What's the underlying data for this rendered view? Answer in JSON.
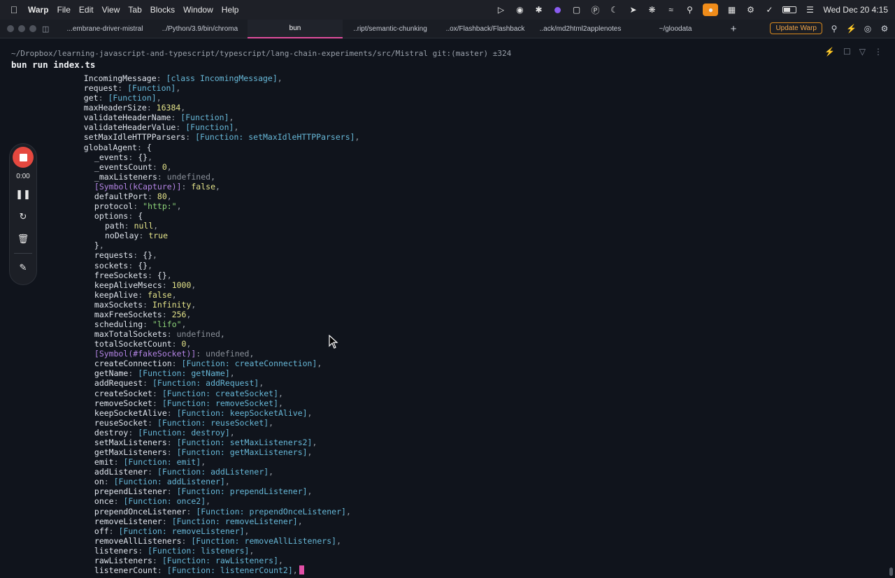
{
  "menubar": {
    "app_name": "Warp",
    "menus": [
      "File",
      "Edit",
      "View",
      "Tab",
      "Blocks",
      "Window",
      "Help"
    ],
    "clock": "Wed Dec 20  4:15"
  },
  "tabbar": {
    "tabs": [
      {
        "label": "...embrane-driver-mistral"
      },
      {
        "label": "../Python/3.9/bin/chroma"
      },
      {
        "label": "bun"
      },
      {
        "label": "..ript/semantic-chunking"
      },
      {
        "label": "..ox/Flashback/Flashback"
      },
      {
        "label": "..ack/md2html2applenotes"
      },
      {
        "label": "~/gloodata"
      }
    ],
    "new_tab_label": "+",
    "update_label": "Update Warp"
  },
  "block": {
    "path": "~/Dropbox/learning-javascript-and-typescript/typescript/lang-chain-experiments/src/Mistral git:(master) ±324",
    "command": "bun run index.ts"
  },
  "output_lines": [
    {
      "indent": 6,
      "segs": [
        [
          "k",
          "IncomingMessage"
        ],
        [
          "p",
          ": "
        ],
        [
          "fn",
          "[class IncomingMessage]"
        ],
        [
          "p",
          ","
        ]
      ]
    },
    {
      "indent": 6,
      "segs": [
        [
          "k",
          "request"
        ],
        [
          "p",
          ": "
        ],
        [
          "fn",
          "[Function]"
        ],
        [
          "p",
          ","
        ]
      ]
    },
    {
      "indent": 6,
      "segs": [
        [
          "k",
          "get"
        ],
        [
          "p",
          ": "
        ],
        [
          "fn",
          "[Function]"
        ],
        [
          "p",
          ","
        ]
      ]
    },
    {
      "indent": 6,
      "segs": [
        [
          "k",
          "maxHeaderSize"
        ],
        [
          "p",
          ": "
        ],
        [
          "num",
          "16384"
        ],
        [
          "p",
          ","
        ]
      ]
    },
    {
      "indent": 6,
      "segs": [
        [
          "k",
          "validateHeaderName"
        ],
        [
          "p",
          ": "
        ],
        [
          "fn",
          "[Function]"
        ],
        [
          "p",
          ","
        ]
      ]
    },
    {
      "indent": 6,
      "segs": [
        [
          "k",
          "validateHeaderValue"
        ],
        [
          "p",
          ": "
        ],
        [
          "fn",
          "[Function]"
        ],
        [
          "p",
          ","
        ]
      ]
    },
    {
      "indent": 6,
      "segs": [
        [
          "k",
          "setMaxIdleHTTPParsers"
        ],
        [
          "p",
          ": "
        ],
        [
          "fn",
          "[Function: setMaxIdleHTTPParsers]"
        ],
        [
          "p",
          ","
        ]
      ]
    },
    {
      "indent": 6,
      "segs": [
        [
          "k",
          "globalAgent"
        ],
        [
          "p",
          ": "
        ],
        [
          "k",
          "{"
        ]
      ]
    },
    {
      "indent": 8,
      "segs": [
        [
          "k",
          "_events"
        ],
        [
          "p",
          ": "
        ],
        [
          "k",
          "{}"
        ],
        [
          "p",
          ","
        ]
      ]
    },
    {
      "indent": 8,
      "segs": [
        [
          "k",
          "_eventsCount"
        ],
        [
          "p",
          ": "
        ],
        [
          "num",
          "0"
        ],
        [
          "p",
          ","
        ]
      ]
    },
    {
      "indent": 8,
      "segs": [
        [
          "k",
          "_maxListeners"
        ],
        [
          "p",
          ": "
        ],
        [
          "undef",
          "undefined"
        ],
        [
          "p",
          ","
        ]
      ]
    },
    {
      "indent": 8,
      "segs": [
        [
          "sym",
          "[Symbol(kCapture)]"
        ],
        [
          "p",
          ": "
        ],
        [
          "bool",
          "false"
        ],
        [
          "p",
          ","
        ]
      ]
    },
    {
      "indent": 8,
      "segs": [
        [
          "k",
          "defaultPort"
        ],
        [
          "p",
          ": "
        ],
        [
          "num",
          "80"
        ],
        [
          "p",
          ","
        ]
      ]
    },
    {
      "indent": 8,
      "segs": [
        [
          "k",
          "protocol"
        ],
        [
          "p",
          ": "
        ],
        [
          "str",
          "\"http:\""
        ],
        [
          "p",
          ","
        ]
      ]
    },
    {
      "indent": 8,
      "segs": [
        [
          "k",
          "options"
        ],
        [
          "p",
          ": "
        ],
        [
          "k",
          "{"
        ]
      ]
    },
    {
      "indent": 10,
      "segs": [
        [
          "k",
          "path"
        ],
        [
          "p",
          ": "
        ],
        [
          "bool",
          "null"
        ],
        [
          "p",
          ","
        ]
      ]
    },
    {
      "indent": 10,
      "segs": [
        [
          "k",
          "noDelay"
        ],
        [
          "p",
          ": "
        ],
        [
          "bool",
          "true"
        ]
      ]
    },
    {
      "indent": 8,
      "segs": [
        [
          "k",
          "}"
        ],
        [
          "p",
          ","
        ]
      ]
    },
    {
      "indent": 8,
      "segs": [
        [
          "k",
          "requests"
        ],
        [
          "p",
          ": "
        ],
        [
          "k",
          "{}"
        ],
        [
          "p",
          ","
        ]
      ]
    },
    {
      "indent": 8,
      "segs": [
        [
          "k",
          "sockets"
        ],
        [
          "p",
          ": "
        ],
        [
          "k",
          "{}"
        ],
        [
          "p",
          ","
        ]
      ]
    },
    {
      "indent": 8,
      "segs": [
        [
          "k",
          "freeSockets"
        ],
        [
          "p",
          ": "
        ],
        [
          "k",
          "{}"
        ],
        [
          "p",
          ","
        ]
      ]
    },
    {
      "indent": 8,
      "segs": [
        [
          "k",
          "keepAliveMsecs"
        ],
        [
          "p",
          ": "
        ],
        [
          "num",
          "1000"
        ],
        [
          "p",
          ","
        ]
      ]
    },
    {
      "indent": 8,
      "segs": [
        [
          "k",
          "keepAlive"
        ],
        [
          "p",
          ": "
        ],
        [
          "bool",
          "false"
        ],
        [
          "p",
          ","
        ]
      ]
    },
    {
      "indent": 8,
      "segs": [
        [
          "k",
          "maxSockets"
        ],
        [
          "p",
          ": "
        ],
        [
          "num",
          "Infinity"
        ],
        [
          "p",
          ","
        ]
      ]
    },
    {
      "indent": 8,
      "segs": [
        [
          "k",
          "maxFreeSockets"
        ],
        [
          "p",
          ": "
        ],
        [
          "num",
          "256"
        ],
        [
          "p",
          ","
        ]
      ]
    },
    {
      "indent": 8,
      "segs": [
        [
          "k",
          "scheduling"
        ],
        [
          "p",
          ": "
        ],
        [
          "str",
          "\"lifo\""
        ],
        [
          "p",
          ","
        ]
      ]
    },
    {
      "indent": 8,
      "segs": [
        [
          "k",
          "maxTotalSockets"
        ],
        [
          "p",
          ": "
        ],
        [
          "undef",
          "undefined"
        ],
        [
          "p",
          ","
        ]
      ]
    },
    {
      "indent": 8,
      "segs": [
        [
          "k",
          "totalSocketCount"
        ],
        [
          "p",
          ": "
        ],
        [
          "num",
          "0"
        ],
        [
          "p",
          ","
        ]
      ]
    },
    {
      "indent": 8,
      "segs": [
        [
          "sym",
          "[Symbol(#fakeSocket)]"
        ],
        [
          "p",
          ": "
        ],
        [
          "undef",
          "undefined"
        ],
        [
          "p",
          ","
        ]
      ]
    },
    {
      "indent": 8,
      "segs": [
        [
          "k",
          "createConnection"
        ],
        [
          "p",
          ": "
        ],
        [
          "fn",
          "[Function: createConnection]"
        ],
        [
          "p",
          ","
        ]
      ]
    },
    {
      "indent": 8,
      "segs": [
        [
          "k",
          "getName"
        ],
        [
          "p",
          ": "
        ],
        [
          "fn",
          "[Function: getName]"
        ],
        [
          "p",
          ","
        ]
      ]
    },
    {
      "indent": 8,
      "segs": [
        [
          "k",
          "addRequest"
        ],
        [
          "p",
          ": "
        ],
        [
          "fn",
          "[Function: addRequest]"
        ],
        [
          "p",
          ","
        ]
      ]
    },
    {
      "indent": 8,
      "segs": [
        [
          "k",
          "createSocket"
        ],
        [
          "p",
          ": "
        ],
        [
          "fn",
          "[Function: createSocket]"
        ],
        [
          "p",
          ","
        ]
      ]
    },
    {
      "indent": 8,
      "segs": [
        [
          "k",
          "removeSocket"
        ],
        [
          "p",
          ": "
        ],
        [
          "fn",
          "[Function: removeSocket]"
        ],
        [
          "p",
          ","
        ]
      ]
    },
    {
      "indent": 8,
      "segs": [
        [
          "k",
          "keepSocketAlive"
        ],
        [
          "p",
          ": "
        ],
        [
          "fn",
          "[Function: keepSocketAlive]"
        ],
        [
          "p",
          ","
        ]
      ]
    },
    {
      "indent": 8,
      "segs": [
        [
          "k",
          "reuseSocket"
        ],
        [
          "p",
          ": "
        ],
        [
          "fn",
          "[Function: reuseSocket]"
        ],
        [
          "p",
          ","
        ]
      ]
    },
    {
      "indent": 8,
      "segs": [
        [
          "k",
          "destroy"
        ],
        [
          "p",
          ": "
        ],
        [
          "fn",
          "[Function: destroy]"
        ],
        [
          "p",
          ","
        ]
      ]
    },
    {
      "indent": 8,
      "segs": [
        [
          "k",
          "setMaxListeners"
        ],
        [
          "p",
          ": "
        ],
        [
          "fn",
          "[Function: setMaxListeners2]"
        ],
        [
          "p",
          ","
        ]
      ]
    },
    {
      "indent": 8,
      "segs": [
        [
          "k",
          "getMaxListeners"
        ],
        [
          "p",
          ": "
        ],
        [
          "fn",
          "[Function: getMaxListeners]"
        ],
        [
          "p",
          ","
        ]
      ]
    },
    {
      "indent": 8,
      "segs": [
        [
          "k",
          "emit"
        ],
        [
          "p",
          ": "
        ],
        [
          "fn",
          "[Function: emit]"
        ],
        [
          "p",
          ","
        ]
      ]
    },
    {
      "indent": 8,
      "segs": [
        [
          "k",
          "addListener"
        ],
        [
          "p",
          ": "
        ],
        [
          "fn",
          "[Function: addListener]"
        ],
        [
          "p",
          ","
        ]
      ]
    },
    {
      "indent": 8,
      "segs": [
        [
          "k",
          "on"
        ],
        [
          "p",
          ": "
        ],
        [
          "fn",
          "[Function: addListener]"
        ],
        [
          "p",
          ","
        ]
      ]
    },
    {
      "indent": 8,
      "segs": [
        [
          "k",
          "prependListener"
        ],
        [
          "p",
          ": "
        ],
        [
          "fn",
          "[Function: prependListener]"
        ],
        [
          "p",
          ","
        ]
      ]
    },
    {
      "indent": 8,
      "segs": [
        [
          "k",
          "once"
        ],
        [
          "p",
          ": "
        ],
        [
          "fn",
          "[Function: once2]"
        ],
        [
          "p",
          ","
        ]
      ]
    },
    {
      "indent": 8,
      "segs": [
        [
          "k",
          "prependOnceListener"
        ],
        [
          "p",
          ": "
        ],
        [
          "fn",
          "[Function: prependOnceListener]"
        ],
        [
          "p",
          ","
        ]
      ]
    },
    {
      "indent": 8,
      "segs": [
        [
          "k",
          "removeListener"
        ],
        [
          "p",
          ": "
        ],
        [
          "fn",
          "[Function: removeListener]"
        ],
        [
          "p",
          ","
        ]
      ]
    },
    {
      "indent": 8,
      "segs": [
        [
          "k",
          "off"
        ],
        [
          "p",
          ": "
        ],
        [
          "fn",
          "[Function: removeListener]"
        ],
        [
          "p",
          ","
        ]
      ]
    },
    {
      "indent": 8,
      "segs": [
        [
          "k",
          "removeAllListeners"
        ],
        [
          "p",
          ": "
        ],
        [
          "fn",
          "[Function: removeAllListeners]"
        ],
        [
          "p",
          ","
        ]
      ]
    },
    {
      "indent": 8,
      "segs": [
        [
          "k",
          "listeners"
        ],
        [
          "p",
          ": "
        ],
        [
          "fn",
          "[Function: listeners]"
        ],
        [
          "p",
          ","
        ]
      ]
    },
    {
      "indent": 8,
      "segs": [
        [
          "k",
          "rawListeners"
        ],
        [
          "p",
          ": "
        ],
        [
          "fn",
          "[Function: rawListeners]"
        ],
        [
          "p",
          ","
        ]
      ]
    },
    {
      "indent": 8,
      "segs": [
        [
          "k",
          "listenerCount"
        ],
        [
          "p",
          ": "
        ],
        [
          "fn",
          "[Function: listenerCount2]"
        ],
        [
          "p",
          ","
        ]
      ]
    }
  ],
  "recorder": {
    "elapsed": "0:00"
  },
  "colors": {
    "active_tab_underline": "#e14d9d",
    "cursor": "#e24fa6",
    "record_button": "#e5483f",
    "update_button": "#f0a64a"
  }
}
